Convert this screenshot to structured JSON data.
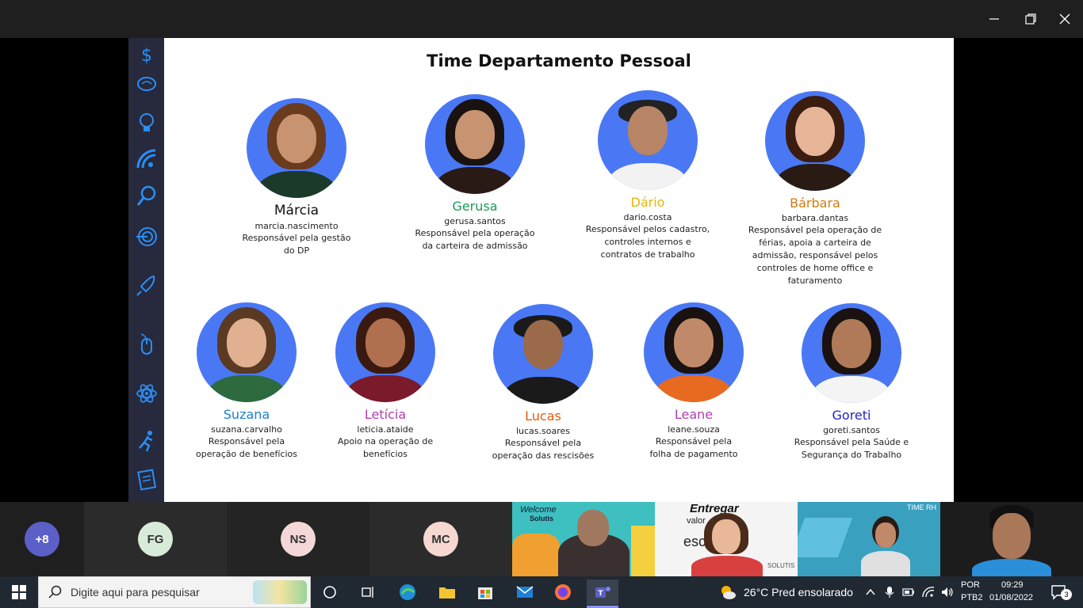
{
  "slide": {
    "title": "Time Departamento Pessoal",
    "row1": [
      {
        "name": "Márcia",
        "name_color": "#111111",
        "user": "marcia.nascimento",
        "role": [
          "Responsável pela gestão",
          "do DP"
        ]
      },
      {
        "name": "Gerusa",
        "name_color": "#1a9a5c",
        "user": "gerusa.santos",
        "role": [
          "Responsável pela operação",
          "da carteira de admissão"
        ]
      },
      {
        "name": "Dário",
        "name_color": "#e6b800",
        "user": "dario.costa",
        "role": [
          "Responsável pelos cadastro,",
          "controles internos e",
          "contratos de trabalho"
        ]
      },
      {
        "name": "Bárbara",
        "name_color": "#d4790a",
        "user": "barbara.dantas",
        "role": [
          "Responsável pela operação de",
          "férias, apoia a carteira de",
          "admissão, responsável pelos",
          "controles de home office e",
          "faturamento"
        ]
      }
    ],
    "row2": [
      {
        "name": "Suzana",
        "name_color": "#1a7fd0",
        "user": "suzana.carvalho",
        "role": [
          "Responsável pela",
          "operação de benefícios"
        ]
      },
      {
        "name": "Letícia",
        "name_color": "#b03fb0",
        "user": "leticia.ataide",
        "role": [
          "Apoio na operação de",
          "benefícios"
        ]
      },
      {
        "name": "Lucas",
        "name_color": "#e05a10",
        "user": "lucas.soares",
        "role": [
          "Responsável pela",
          "operação das rescisões"
        ]
      },
      {
        "name": "Leane",
        "name_color": "#b03fb0",
        "user": "leane.souza",
        "role": [
          "Responsável pela",
          "folha de pagamento"
        ]
      },
      {
        "name": "Goreti",
        "name_color": "#2222c8",
        "user": "goreti.santos",
        "role": [
          "Responsável pela Saúde e",
          "Segurança do Trabalho"
        ]
      }
    ]
  },
  "participants": {
    "overflow": "+8",
    "tiles": [
      {
        "initials": "FG",
        "color": "#d8ead8"
      },
      {
        "initials": "NS",
        "color": "#f4d8d8"
      },
      {
        "initials": "MC",
        "color": "#f6d8d0"
      }
    ],
    "video_texts": {
      "welcome": "Welcome",
      "solutis": "Solutis",
      "entregar": "Entregar",
      "valor": "valor",
      "esc": "esc",
      "solutis2": "SOLUTIS",
      "time_rh": "TIME RH"
    }
  },
  "taskbar": {
    "search_placeholder": "Digite aqui para pesquisar",
    "weather": "26°C  Pred ensolarado",
    "lang": "POR",
    "layout": "PTB2",
    "time": "09:29",
    "date": "01/08/2022",
    "notifications": "3"
  },
  "colors": {
    "avatar_bg": "#4a78f5",
    "slide_sidebar": "#27293d",
    "sidebar_icons": "#2a8ff5"
  }
}
